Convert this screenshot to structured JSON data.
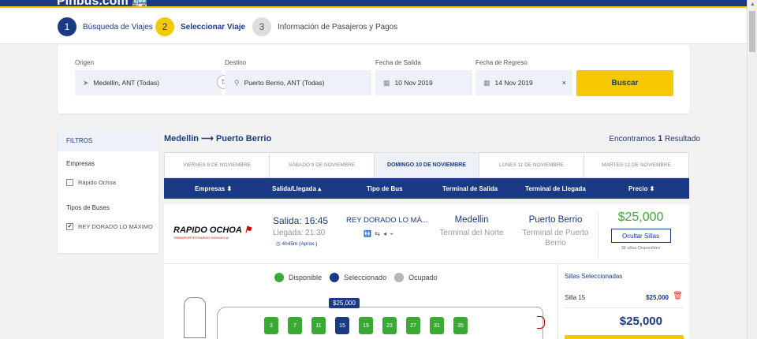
{
  "brand": {
    "name": "Pinbus.com",
    "bus_icon": "bus-icon"
  },
  "steps": [
    {
      "num": "1",
      "label": "Búsqueda de Viajes"
    },
    {
      "num": "2",
      "label": "Seleccionar Viaje"
    },
    {
      "num": "3",
      "label": "Información de Pasajeros y Pagos"
    }
  ],
  "search": {
    "origin_label": "Origen",
    "origin_value": "Medellin, ANT (Todas)",
    "dest_label": "Destino",
    "dest_value": "Puerto Berrio, ANT (Todas)",
    "depart_label": "Fecha de Salida",
    "depart_value": "10 Nov 2019",
    "return_label": "Fecha de Regreso",
    "return_value": "14 Nov 2019",
    "clear_icon": "×",
    "button": "Buscar"
  },
  "filters": {
    "title": "FILTROS",
    "companies_title": "Empresas",
    "companies": [
      {
        "label": "Rápido Ochoa",
        "checked": false
      }
    ],
    "bus_types_title": "Tipos de Buses",
    "bus_types": [
      {
        "label": "REY DORADO LO MÁXIMO",
        "checked": true
      }
    ]
  },
  "results": {
    "route": "Medellin ⟶ Puerto Berrio",
    "found_prefix": "Encontramos ",
    "found_count": "1",
    "found_suffix": " Resultado"
  },
  "dates": [
    {
      "label": "VIERNES 8 DE NOVIEMBRE",
      "active": false
    },
    {
      "label": "SÁBADO 9 DE NOVIEMBRE",
      "active": false
    },
    {
      "label": "DOMINGO 10 DE NOVIEMBRE",
      "active": true
    },
    {
      "label": "LUNES 11 DE NOVIEMBRE",
      "active": false
    },
    {
      "label": "MARTES 12 DE NOVIEMBRE",
      "active": false
    }
  ],
  "columns": [
    "Empresas ⬍",
    "Salida/Llegada ▴",
    "Tipo de Bus",
    "Terminal de Salida",
    "Terminal de Llegada",
    "Precio ⬍"
  ],
  "trip": {
    "company_logo_text": "RAPIDO OCHOA",
    "company_logo_sub": "TRANSPORTES RAPIDO OCHOA S.A.",
    "departure": "Salida: 16:45",
    "arrival": "Llegada: 21:30",
    "duration": "◷ 4h45m (Aprox.)",
    "bus_type": "REY DORADO LO MÁ...",
    "amenities": "🚻 ⇆ ◂ ⌁",
    "origin_city": "Medellin",
    "origin_terminal": "Terminal del Norte",
    "dest_city": "Puerto Berrio",
    "dest_terminal": "Terminal de Puerto Berrio",
    "price": "$25,000",
    "hide_button": "Ocultar Sillas",
    "available": "38 sillas Disponibles"
  },
  "legend": [
    {
      "label": "Disponible",
      "color": "#3aaa35"
    },
    {
      "label": "Seleccionado",
      "color": "#1a3a86"
    },
    {
      "label": "Ocupado",
      "color": "#b5b5b5"
    }
  ],
  "seat_tooltip": "$25,000",
  "seats": [
    {
      "num": "3",
      "state": "available"
    },
    {
      "num": "7",
      "state": "available"
    },
    {
      "num": "11",
      "state": "available"
    },
    {
      "num": "15",
      "state": "selected"
    },
    {
      "num": "19",
      "state": "available"
    },
    {
      "num": "23",
      "state": "available"
    },
    {
      "num": "27",
      "state": "available"
    },
    {
      "num": "31",
      "state": "available"
    },
    {
      "num": "35",
      "state": "available"
    }
  ],
  "selection": {
    "title": "Sillas Seleccionadas",
    "seat_label": "Silla 15",
    "seat_price": "$25,000",
    "total": "$25,000"
  }
}
